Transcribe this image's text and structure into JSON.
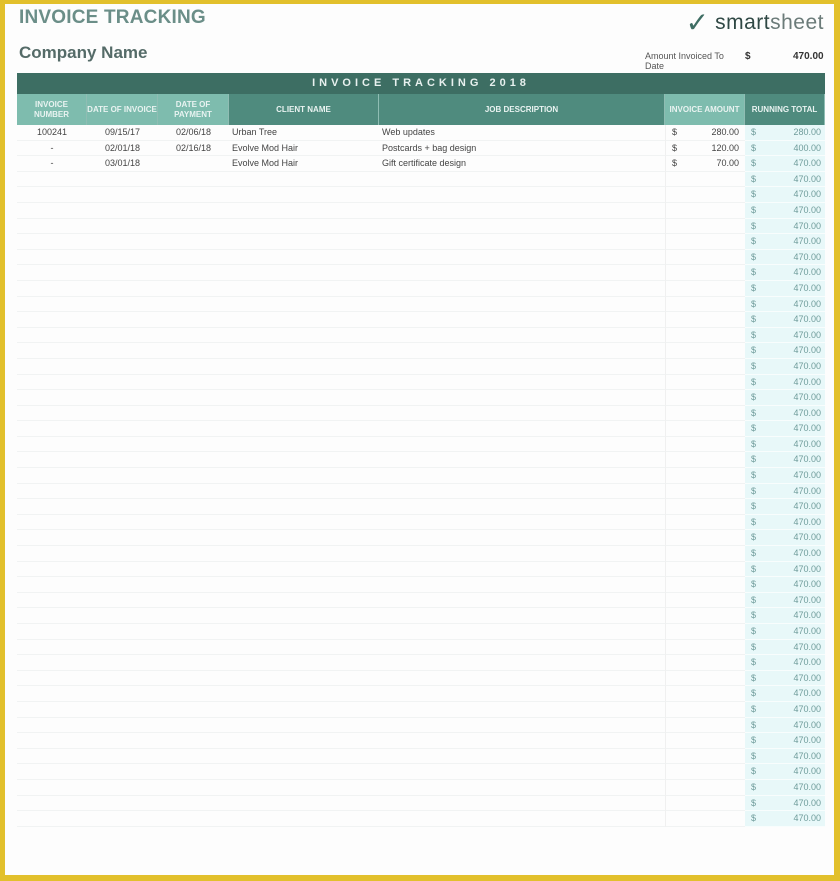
{
  "header": {
    "title": "INVOICE TRACKING",
    "company": "Company Name",
    "logo_check": "✓",
    "logo_word_bold": "smart",
    "logo_word_light": "sheet",
    "amount_label": "Amount Invoiced To Date",
    "amount_currency": "$",
    "amount_value": "470.00"
  },
  "table": {
    "banner": "INVOICE TRACKING 2018",
    "columns": [
      "INVOICE NUMBER",
      "DATE OF INVOICE",
      "DATE OF PAYMENT",
      "CLIENT NAME",
      "JOB DESCRIPTION",
      "INVOICE AMOUNT",
      "RUNNING TOTAL"
    ],
    "currency": "$",
    "rows": [
      {
        "number": "100241",
        "invoice_date": "09/15/17",
        "payment_date": "02/06/18",
        "client": "Urban Tree",
        "description": "Web updates",
        "amount": "280.00",
        "running": "280.00"
      },
      {
        "number": "-",
        "invoice_date": "02/01/18",
        "payment_date": "02/16/18",
        "client": "Evolve Mod Hair",
        "description": "Postcards + bag design",
        "amount": "120.00",
        "running": "400.00"
      },
      {
        "number": "-",
        "invoice_date": "03/01/18",
        "payment_date": "",
        "client": "Evolve Mod Hair",
        "description": "Gift certificate design",
        "amount": "70.00",
        "running": "470.00"
      }
    ],
    "empty_row_running": "470.00",
    "empty_row_count": 42
  }
}
